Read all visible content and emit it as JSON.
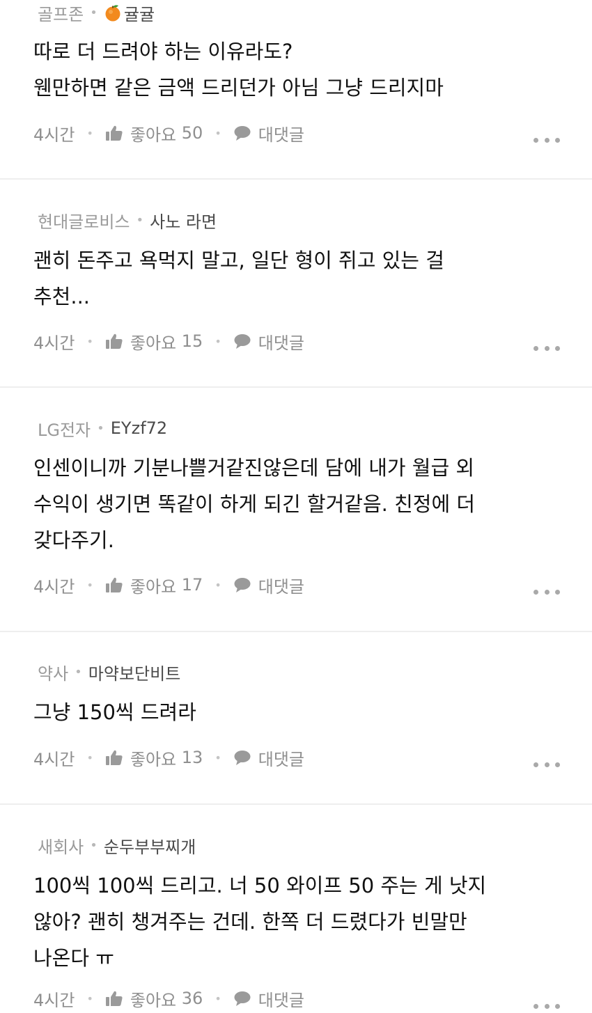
{
  "comments": [
    {
      "company": "골프존",
      "nickname": "귤귤",
      "lines": [
        "따로 더 드려야 하는 이유라도?",
        "웬만하면 같은 금액 드리던가 아님 그냥 드리지마"
      ],
      "time": "4시간",
      "like_label": "좋아요",
      "like_count": "50",
      "reply_label": "대댓글"
    },
    {
      "company": "현대글로비스",
      "nickname": "사노 라면",
      "lines": [
        "괜히 돈주고 욕먹지 말고, 일단 형이 쥐고 있는 걸",
        "추천..."
      ],
      "time": "4시간",
      "like_label": "좋아요",
      "like_count": "15",
      "reply_label": "대댓글"
    },
    {
      "company": "LG전자",
      "nickname": "EYzf72",
      "lines": [
        "인센이니까 기분나쁠거같진않은데 담에 내가 월급 외",
        "수익이 생기면 똑같이 하게 되긴 할거같음. 친정에 더",
        "갖다주기."
      ],
      "time": "4시간",
      "like_label": "좋아요",
      "like_count": "17",
      "reply_label": "대댓글"
    },
    {
      "company": "약사",
      "nickname": "마약보단비트",
      "lines": [
        "그냥 150씩 드려라"
      ],
      "time": "4시간",
      "like_label": "좋아요",
      "like_count": "13",
      "reply_label": "대댓글"
    },
    {
      "company": "새회사",
      "nickname": "순두부부찌개",
      "lines": [
        "100씩 100씩 드리고. 너 50 와이프 50 주는 게 낫지",
        "않아? 괜히 챙겨주는 건데. 한쪽 더 드렸다가 빈말만",
        "나온다 ㅠ"
      ],
      "time": "4시간",
      "like_label": "좋아요",
      "like_count": "36",
      "reply_label": "대댓글"
    }
  ],
  "icons": {
    "badge": "orange-emoji-icon",
    "like": "thumbs-up-icon",
    "reply": "speech-bubble-icon",
    "more": "more-dots-icon"
  },
  "colors": {
    "company": "#9a9a9a",
    "nickname": "#4a4a4a",
    "body": "#111111",
    "action": "#8f8f8f",
    "divider": "#eeeeee"
  }
}
